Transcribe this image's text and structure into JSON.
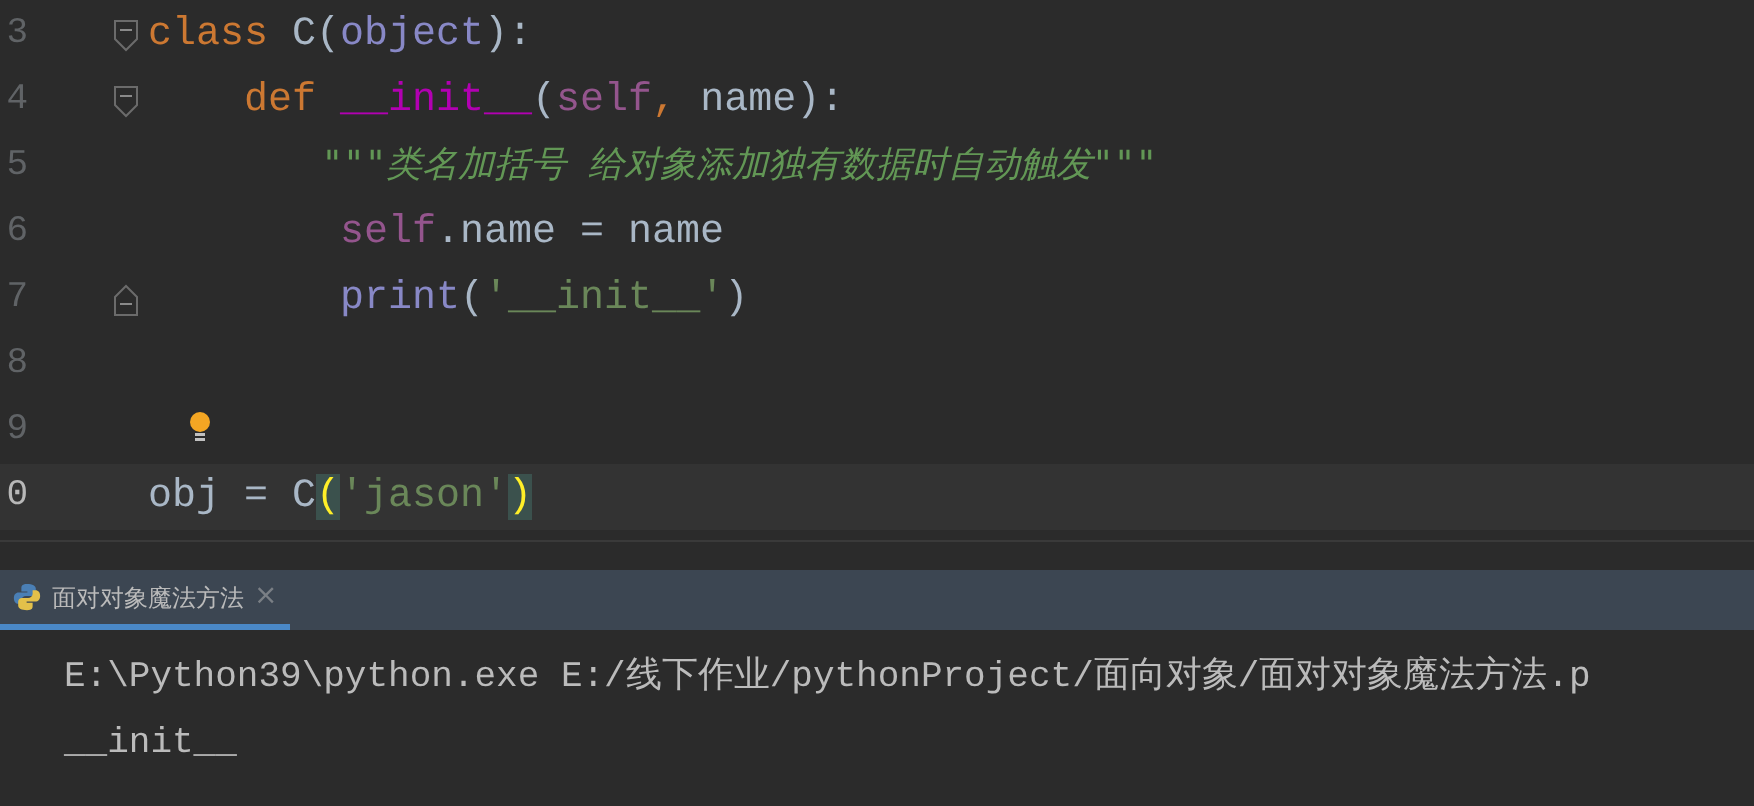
{
  "editor": {
    "lines": [
      {
        "number": "3",
        "fold_start": true,
        "fold_end": false,
        "current": false,
        "tokens": [
          {
            "kind": "keyword",
            "text": "class"
          },
          {
            "kind": "plain",
            "text": " C("
          },
          {
            "kind": "builtin",
            "text": "object"
          },
          {
            "kind": "plain",
            "text": "):"
          }
        ]
      },
      {
        "number": "4",
        "fold_start": true,
        "fold_end": false,
        "current": false,
        "tokens": [
          {
            "kind": "keyword",
            "text": "    def "
          },
          {
            "kind": "magic",
            "text": "__init__"
          },
          {
            "kind": "plain",
            "text": "("
          },
          {
            "kind": "self",
            "text": "self"
          },
          {
            "kind": "keyword",
            "text": ","
          },
          {
            "kind": "plain",
            "text": " name):"
          }
        ]
      },
      {
        "number": "5",
        "fold_start": false,
        "fold_end": false,
        "current": false,
        "tokens": [
          {
            "kind": "docstring",
            "text": "        \"\"\"类名加括号 给对象添加独有数据时自动触发\"\"\""
          }
        ]
      },
      {
        "number": "6",
        "fold_start": false,
        "fold_end": false,
        "current": false,
        "tokens": [
          {
            "kind": "self",
            "text": "        self"
          },
          {
            "kind": "plain",
            "text": ".name = name"
          }
        ]
      },
      {
        "number": "7",
        "fold_start": false,
        "fold_end": true,
        "current": false,
        "tokens": [
          {
            "kind": "builtin",
            "text": "        print"
          },
          {
            "kind": "plain",
            "text": "("
          },
          {
            "kind": "string",
            "text": "'__init__'"
          },
          {
            "kind": "plain",
            "text": ")"
          }
        ]
      },
      {
        "number": "8",
        "fold_start": false,
        "fold_end": false,
        "current": false
      },
      {
        "number": "9",
        "fold_start": false,
        "fold_end": false,
        "current": false,
        "bulb": true
      },
      {
        "number": "0",
        "fold_start": false,
        "fold_end": false,
        "current": true,
        "tokens": [
          {
            "kind": "plain",
            "text": "obj = C"
          },
          {
            "kind": "brace",
            "text": "("
          },
          {
            "kind": "string",
            "text": "'jason'"
          },
          {
            "kind": "brace",
            "text": ")"
          }
        ]
      }
    ]
  },
  "run_tab": {
    "label": "面对对象魔法方法",
    "close": "×",
    "selected": true
  },
  "console": {
    "lines": [
      "E:\\Python39\\python.exe E:/线下作业/pythonProject/面向对象/面对对象魔法方法.p",
      "__init__"
    ]
  }
}
